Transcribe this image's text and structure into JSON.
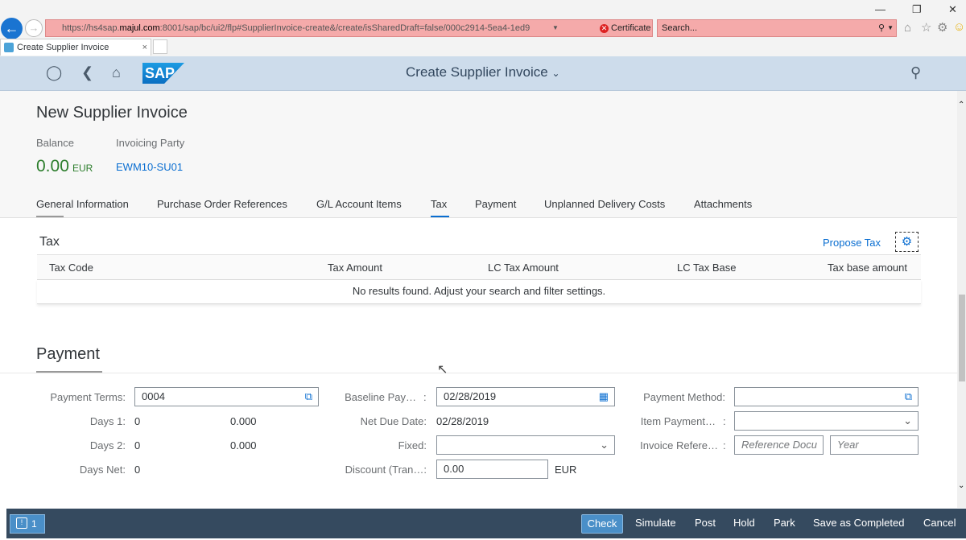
{
  "browser": {
    "url_prefix": "https://hs4sap.",
    "url_host": "majul.com",
    "url_rest": ":8001/sap/bc/ui2/flp#SupplierInvoice-create&/create/isSharedDraft=false/000c2914-5ea4-1ed9",
    "cert_error": "Certificate error",
    "search_placeholder": "Search...",
    "tab_title": "Create Supplier Invoice"
  },
  "shell": {
    "app_title": "Create Supplier Invoice",
    "logo_text": "SAP"
  },
  "header": {
    "title": "New Supplier Invoice",
    "balance_label": "Balance",
    "balance_value": "0.00",
    "balance_currency": "EUR",
    "party_label": "Invoicing Party",
    "party_value": "EWM10-SU01"
  },
  "tabs": [
    {
      "label": "General Information"
    },
    {
      "label": "Purchase Order References"
    },
    {
      "label": "G/L Account Items"
    },
    {
      "label": "Tax",
      "selected": true
    },
    {
      "label": "Payment"
    },
    {
      "label": "Unplanned Delivery Costs"
    },
    {
      "label": "Attachments"
    }
  ],
  "tax": {
    "title": "Tax",
    "propose_label": "Propose Tax",
    "columns": [
      "Tax Code",
      "Tax Amount",
      "LC Tax Amount",
      "LC Tax Base",
      "Tax base amount"
    ],
    "empty_text": "No results found. Adjust your search and filter settings."
  },
  "payment": {
    "title": "Payment",
    "payment_terms_label": "Payment Terms:",
    "payment_terms_value": "0004",
    "days1_label": "Days 1:",
    "days1_days": "0",
    "days1_pct": "0.000",
    "days2_label": "Days 2:",
    "days2_days": "0",
    "days2_pct": "0.000",
    "days_net_label": "Days Net:",
    "days_net_value": "0",
    "baseline_label": "Baseline Pay…",
    "baseline_value": "02/28/2019",
    "net_due_label": "Net Due Date:",
    "net_due_value": "02/28/2019",
    "fixed_label": "Fixed:",
    "fixed_value": "",
    "discount_label": "Discount (Tran…:",
    "discount_value": "0.00",
    "discount_currency": "EUR",
    "method_label": "Payment Method:",
    "method_value": "",
    "item_payment_label": "Item Payment…",
    "item_payment_value": "",
    "invoice_ref_label": "Invoice Refere…",
    "ref_doc_placeholder": "Reference Docu",
    "year_placeholder": "Year"
  },
  "footer": {
    "messages_count": "1",
    "buttons": [
      "Check",
      "Simulate",
      "Post",
      "Hold",
      "Park",
      "Save as Completed",
      "Cancel"
    ]
  }
}
